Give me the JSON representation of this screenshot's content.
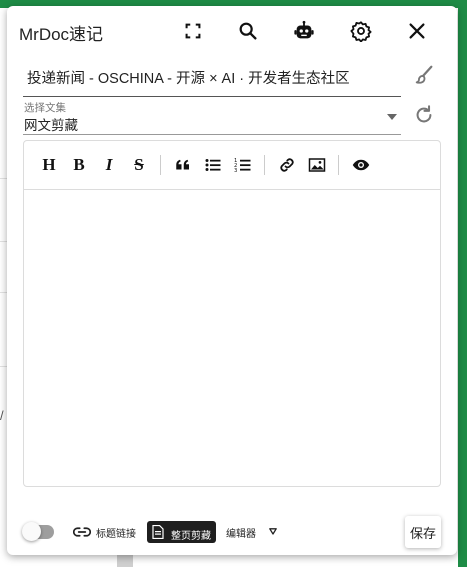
{
  "header": {
    "title": "MrDoc速记",
    "icons": [
      "fullscreen-icon",
      "search-icon",
      "robot-icon",
      "settings-icon",
      "close-icon"
    ]
  },
  "doc_title": {
    "value": "投递新闻 - OSCHINA - 开源 × AI · 开发者生态社区"
  },
  "collection_select": {
    "label": "选择文集",
    "value": "网文剪藏"
  },
  "toolbar": {
    "heading": "H",
    "bold": "B",
    "italic": "I",
    "strike": "S"
  },
  "footer": {
    "title_link_label": "标题链接",
    "fullpage_label": "整页剪藏",
    "editor_label": "编辑器",
    "save_label": "保存"
  },
  "colors": {
    "accent_green": "#1e8c46",
    "fullpage_bg": "#1f1f1f"
  }
}
